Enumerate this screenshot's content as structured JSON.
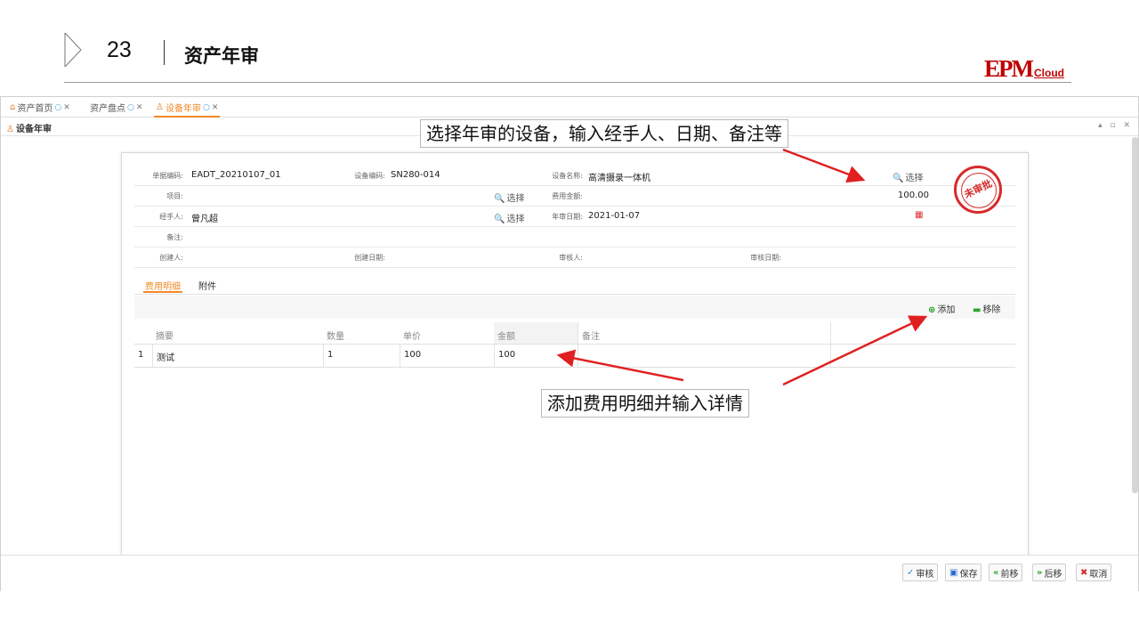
{
  "slide": {
    "number": "23",
    "title": "资产年审",
    "logo_big": "EPM",
    "logo_small": "Cloud"
  },
  "tabs": [
    {
      "label": "资产首页",
      "icon": "home-icon"
    },
    {
      "label": "资产盘点",
      "icon": ""
    },
    {
      "label": "设备年审",
      "icon": "user-icon"
    }
  ],
  "page": {
    "title": "设备年审",
    "window_controls": "▴ ▫ ✕"
  },
  "form": {
    "doc_no_label": "单据编码:",
    "doc_no": "EADT_20210107_01",
    "device_code_label": "设备编码:",
    "device_code": "SN280-014",
    "device_name_label": "设备名称:",
    "device_name": "高清摄录一体机",
    "select_label": "选择",
    "project_label": "项目:",
    "project": "",
    "fee_amount_label": "费用金额:",
    "fee_amount": "100.00",
    "handler_label": "经手人:",
    "handler": "曾凡超",
    "review_date_label": "年审日期:",
    "review_date": "2021-01-07",
    "remark_label": "备注:",
    "remark": "",
    "creator_label": "创建人:",
    "create_date_label": "创建日期:",
    "approver_label": "审核人:",
    "approve_date_label": "审核日期:",
    "stamp_text": "未审批"
  },
  "detail_tabs": [
    {
      "label": "费用明细"
    },
    {
      "label": "附件"
    }
  ],
  "grid_tools": {
    "add_label": "添加",
    "remove_label": "移除"
  },
  "grid": {
    "columns": [
      "摘要",
      "数量",
      "单价",
      "金额",
      "备注"
    ],
    "rows": [
      {
        "index": "1",
        "summary": "测试",
        "qty": "1",
        "price": "100",
        "amount": "100",
        "note": ""
      }
    ]
  },
  "bottom_buttons": [
    {
      "label": "审核",
      "icon": "check-icon",
      "color": "#3a8ad6"
    },
    {
      "label": "保存",
      "icon": "save-icon",
      "color": "#2a6ac8"
    },
    {
      "label": "前移",
      "icon": "prev-icon",
      "color": "#2aa52a"
    },
    {
      "label": "后移",
      "icon": "next-icon",
      "color": "#2aa52a"
    },
    {
      "label": "取消",
      "icon": "cancel-icon",
      "color": "#d62a2a"
    }
  ],
  "annotations": {
    "top": "选择年审的设备，输入经手人、日期、备注等",
    "bottom": "添加费用明细并输入详情"
  },
  "colors": {
    "accent": "#f08a2a",
    "annotation_arrow": "#e02020",
    "brand": "#c00000"
  }
}
